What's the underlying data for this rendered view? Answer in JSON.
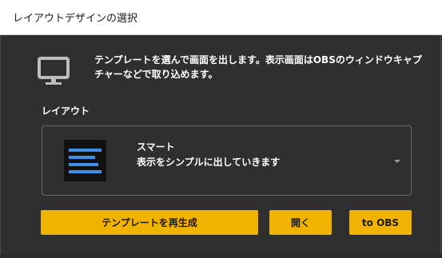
{
  "window": {
    "title": "レイアウトデザインの選択"
  },
  "description": {
    "line1": "テンプレートを選んで画面を出します。表示画面はOBSのウィンドウキャプ",
    "line2": "チャーなどで取り込めます。",
    "icon": "monitor-icon"
  },
  "layout_section": {
    "label": "レイアウト",
    "selected": {
      "name": "スマート",
      "description": "表示をシンプルに出していきます",
      "thumbnail_color": "#3d8ee6"
    }
  },
  "buttons": {
    "regenerate_label": "テンプレートを再生成",
    "open_label": "開く",
    "to_obs_label": "to OBS"
  },
  "colors": {
    "accent": "#f0b400",
    "background": "#2f2f2f"
  }
}
